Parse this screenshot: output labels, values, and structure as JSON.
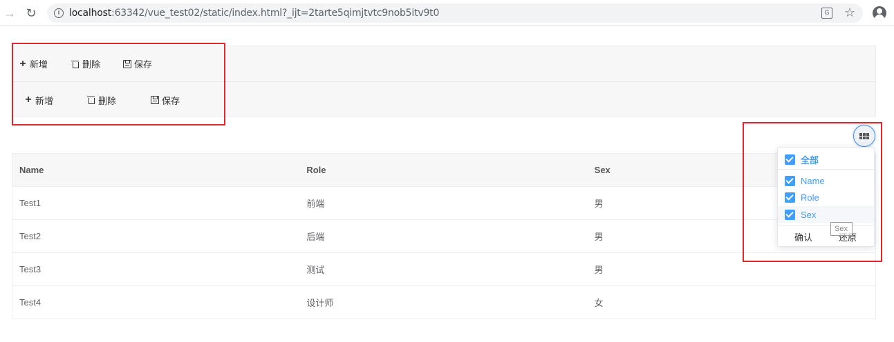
{
  "browser": {
    "url_host": "localhost",
    "url_rest": ":63342/vue_test02/static/index.html?_ijt=2tarte5qimjtvtc9nob5itv9t0"
  },
  "toolbar1": {
    "add": "新增",
    "delete": "删除",
    "save": "保存"
  },
  "toolbar2": {
    "add": "新增",
    "delete": "删除",
    "save": "保存"
  },
  "table": {
    "headers": [
      "Name",
      "Role",
      "Sex"
    ],
    "rows": [
      [
        "Test1",
        "前端",
        "男"
      ],
      [
        "Test2",
        "后端",
        "男"
      ],
      [
        "Test3",
        "测试",
        "男"
      ],
      [
        "Test4",
        "设计师",
        "女"
      ]
    ]
  },
  "column_menu": {
    "all": "全部",
    "items": [
      "Name",
      "Role",
      "Sex"
    ],
    "confirm": "确认",
    "reset": "还原",
    "drag_tip": "Sex"
  },
  "colors": {
    "accent": "#409eff",
    "highlight_box": "#e4252a"
  }
}
